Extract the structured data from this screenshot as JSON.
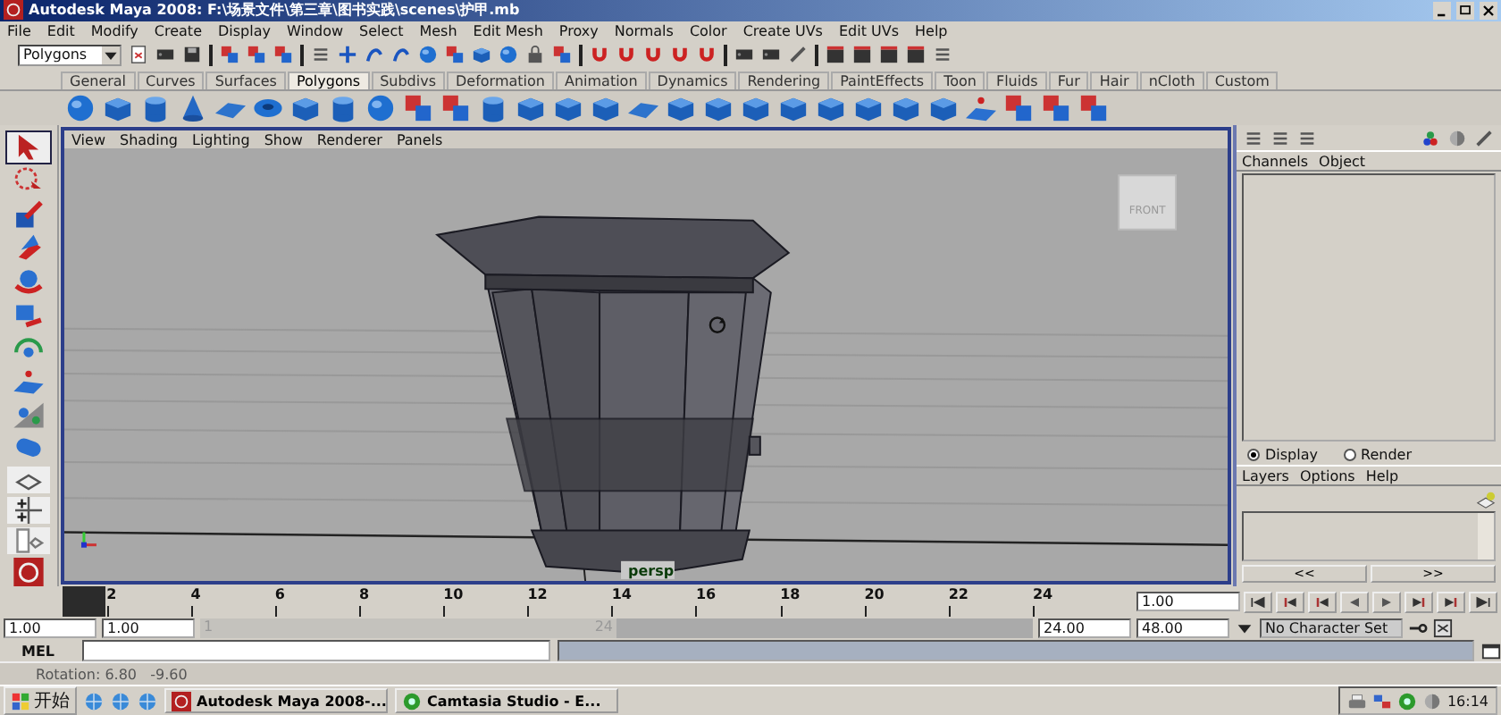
{
  "window": {
    "title": "Autodesk Maya 2008:  F:\\场景文件\\第三章\\图书实践\\scenes\\护甲.mb"
  },
  "menu_bar": [
    "File",
    "Edit",
    "Modify",
    "Create",
    "Display",
    "Window",
    "Select",
    "Mesh",
    "Edit Mesh",
    "Proxy",
    "Normals",
    "Color",
    "Create UVs",
    "Edit UVs",
    "Help"
  ],
  "status_line": {
    "menu_set": "Polygons"
  },
  "shelf_tabs": [
    {
      "label": "General",
      "selected": false
    },
    {
      "label": "Curves",
      "selected": false
    },
    {
      "label": "Surfaces",
      "selected": false
    },
    {
      "label": "Polygons",
      "selected": true
    },
    {
      "label": "Subdivs",
      "selected": false
    },
    {
      "label": "Deformation",
      "selected": false
    },
    {
      "label": "Animation",
      "selected": false
    },
    {
      "label": "Dynamics",
      "selected": false
    },
    {
      "label": "Rendering",
      "selected": false
    },
    {
      "label": "PaintEffects",
      "selected": false
    },
    {
      "label": "Toon",
      "selected": false
    },
    {
      "label": "Fluids",
      "selected": false
    },
    {
      "label": "Fur",
      "selected": false
    },
    {
      "label": "Hair",
      "selected": false
    },
    {
      "label": "nCloth",
      "selected": false
    },
    {
      "label": "Custom",
      "selected": false
    }
  ],
  "viewport": {
    "menu": [
      "View",
      "Shading",
      "Lighting",
      "Show",
      "Renderer",
      "Panels"
    ],
    "view_cube": "FRONT",
    "camera": "persp"
  },
  "channel_box": {
    "menu": [
      "Channels",
      "Object"
    ]
  },
  "layer_editor": {
    "modes": [
      {
        "label": "Display",
        "selected": true
      },
      {
        "label": "Render",
        "selected": false
      }
    ],
    "menu": [
      "Layers",
      "Options",
      "Help"
    ],
    "nav": [
      "<<",
      ">>"
    ]
  },
  "time_slider": {
    "ticks": [
      "2",
      "4",
      "6",
      "8",
      "10",
      "12",
      "14",
      "16",
      "18",
      "20",
      "22",
      "24"
    ],
    "current_frame": "1.00",
    "level": 0
  },
  "range_slider": {
    "start": "1.00",
    "playback_start": "1.00",
    "range_start": "1",
    "range_end": "24",
    "level": 0.5,
    "playback_end": "24.00",
    "end": "48.00",
    "character_set": "No Character Set"
  },
  "command_line": {
    "label": "MEL"
  },
  "help_line": "Rotation: 6.80   -9.60",
  "taskbar": {
    "start": "开始",
    "tasks": [
      "Autodesk Maya 2008-...",
      "Camtasia Studio - E..."
    ],
    "clock": "16:14"
  }
}
